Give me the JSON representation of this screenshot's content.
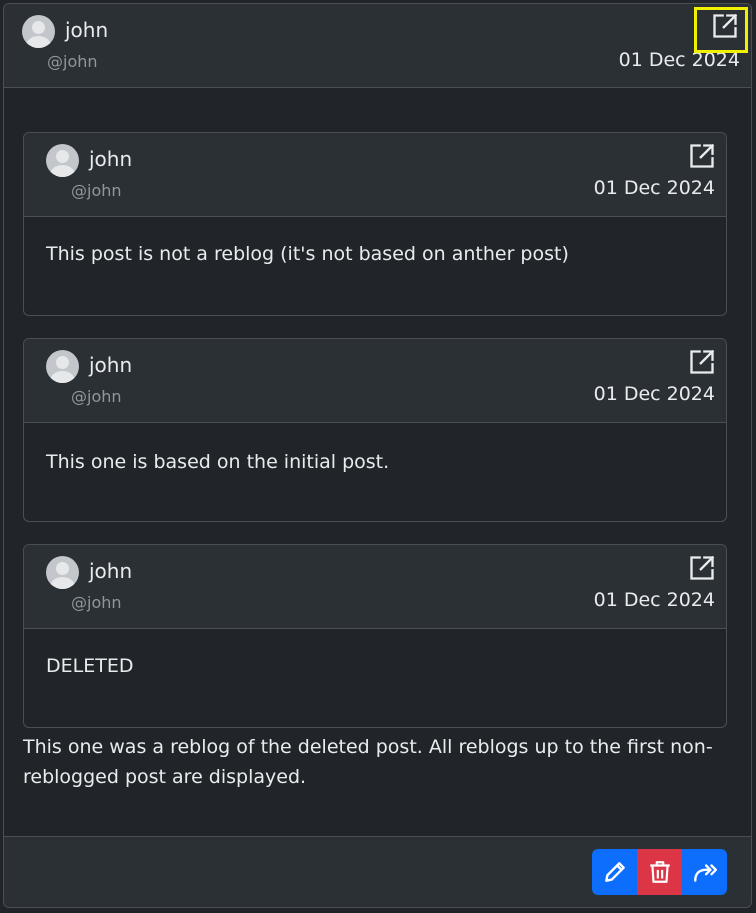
{
  "post": {
    "author": "john",
    "handle": "@john",
    "date": "01 Dec 2024",
    "body": "This one was a reblog of the deleted post. All reblogs up to the first non-reblogged post are displayed."
  },
  "reblogs": [
    {
      "author": "john",
      "handle": "@john",
      "date": "01 Dec 2024",
      "body": "This post is not a reblog (it's not based on anther post)"
    },
    {
      "author": "john",
      "handle": "@john",
      "date": "01 Dec 2024",
      "body": "This one is based on the initial post."
    },
    {
      "author": "john",
      "handle": "@john",
      "date": "01 Dec 2024",
      "body": "DELETED"
    }
  ],
  "icons": {
    "open": "external-link-icon",
    "edit": "pencil-icon",
    "delete": "trash-icon",
    "reblog": "double-forward-icon"
  },
  "colors": {
    "primary": "#0d6efd",
    "danger": "#dc3545",
    "highlight": "#f0f000"
  }
}
